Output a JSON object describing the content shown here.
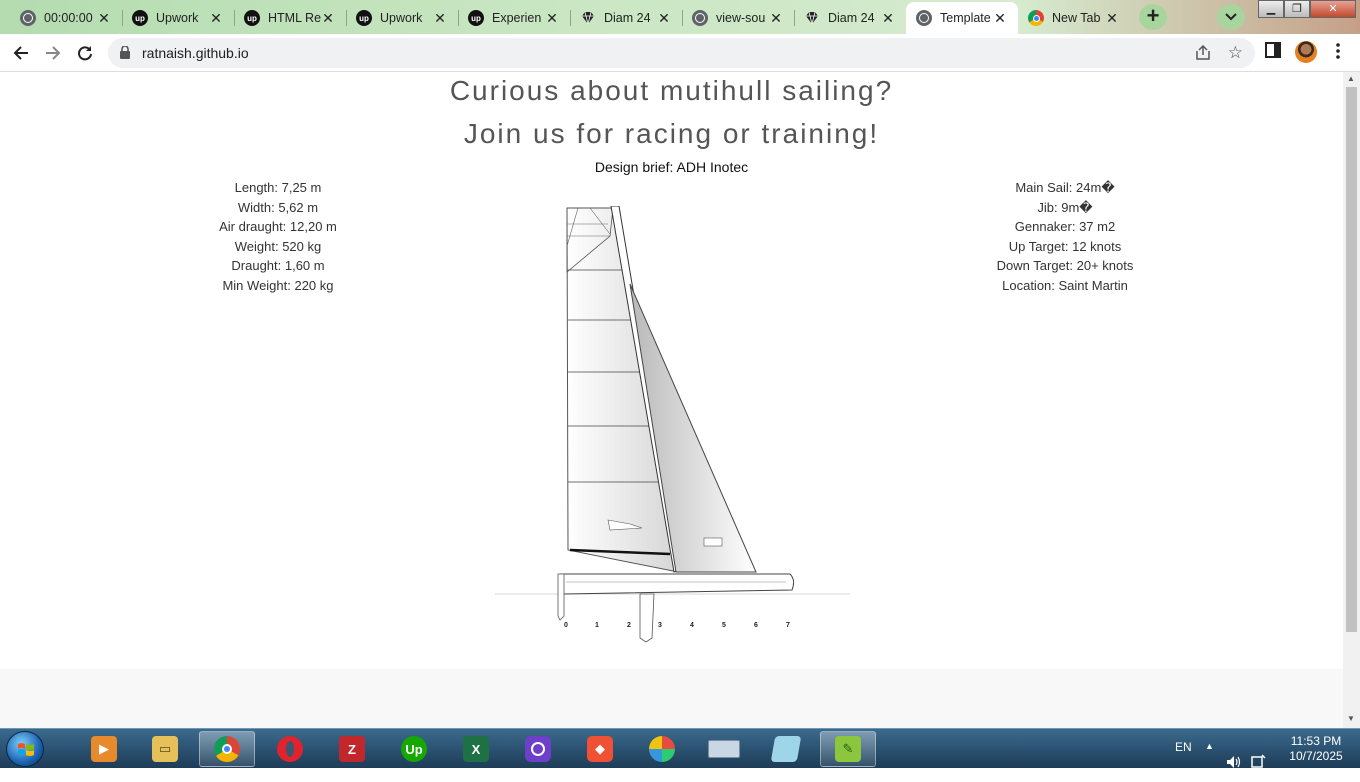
{
  "browser": {
    "tabs": [
      {
        "label": "00:00:00",
        "icon": "globe-icon"
      },
      {
        "label": "Upwork",
        "icon": "upwork-icon"
      },
      {
        "label": "HTML Re",
        "icon": "upwork-icon"
      },
      {
        "label": "Upwork",
        "icon": "upwork-icon"
      },
      {
        "label": "Experien",
        "icon": "upwork-icon"
      },
      {
        "label": "Diam 24",
        "icon": "diamond-icon"
      },
      {
        "label": "view-sou",
        "icon": "globe-icon"
      },
      {
        "label": "Diam 24",
        "icon": "diamond-icon"
      },
      {
        "label": "Template",
        "icon": "globe-icon",
        "active": true
      },
      {
        "label": "New Tab",
        "icon": "chrome-icon"
      }
    ],
    "url": "ratnaish.github.io",
    "accent": "#b4dcb0"
  },
  "page": {
    "headline1": "Curious about mutihull sailing?",
    "headline2": "Join us for racing or training!",
    "brief": "Design brief: ADH Inotec",
    "left_specs": [
      "Length: 7,25 m",
      "Width: 5,62 m",
      "Air draught: 12,20 m",
      "Weight: 520 kg",
      "Draught: 1,60 m",
      "Min Weight: 220 kg"
    ],
    "right_specs": [
      "Main Sail: 24m�",
      "Jib: 9m�",
      "Gennaker: 37 m2",
      "Up Target: 12 knots",
      "Down Target: 20+ knots",
      "Location: Saint Martin"
    ],
    "scale_marks": [
      "0",
      "1",
      "2",
      "3",
      "4",
      "5",
      "6",
      "7"
    ]
  },
  "taskbar": {
    "apps": [
      {
        "name": "media-player-icon",
        "color": "#e8892b"
      },
      {
        "name": "file-explorer-icon",
        "color": "#e6c15a"
      },
      {
        "name": "chrome-icon",
        "color": "#4285f4"
      },
      {
        "name": "opera-icon",
        "color": "#e0232d"
      },
      {
        "name": "filezilla-icon",
        "color": "#c1272d",
        "text": "Z"
      },
      {
        "name": "upwork-icon",
        "color": "#14a800",
        "text": "Up"
      },
      {
        "name": "excel-icon",
        "color": "#1e7145",
        "text": "X"
      },
      {
        "name": "github-desktop-icon",
        "color": "#6e40c9"
      },
      {
        "name": "git-icon",
        "color": "#f05033"
      },
      {
        "name": "color-picker-icon",
        "color": "#ffffff"
      },
      {
        "name": "keyboard-icon",
        "color": "#c9d6e3"
      },
      {
        "name": "notepad-icon",
        "color": "#9fd5e8"
      },
      {
        "name": "notepad-plus-icon",
        "color": "#8cc63f"
      }
    ],
    "language": "EN",
    "time": "11:53 PM",
    "date": "10/7/2025"
  }
}
